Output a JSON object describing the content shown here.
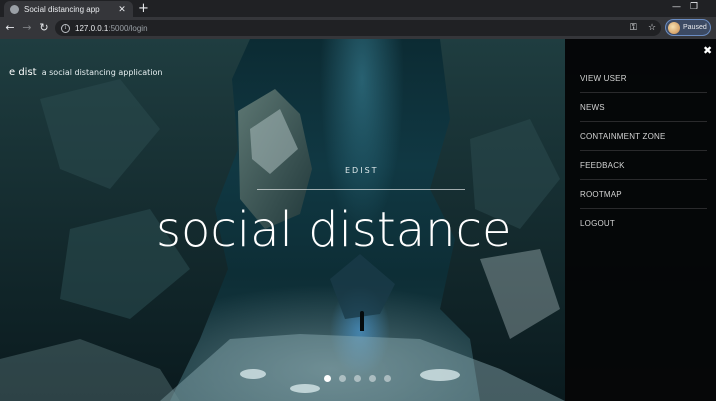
{
  "browser": {
    "tab_title": "Social distancing app",
    "tab_close": "✕",
    "new_tab": "+",
    "url_host": "127.0.0.1",
    "url_path": ":5000/login",
    "profile_label": "Paused",
    "icons": {
      "back": "back-arrow-icon",
      "forward": "forward-arrow-icon",
      "reload": "reload-icon",
      "info": "site-info-icon",
      "key": "password-key-icon",
      "star": "bookmark-star-icon",
      "minimize": "minimize-icon",
      "restore": "restore-icon"
    }
  },
  "page": {
    "brand_name": "e dist",
    "brand_tagline": "a social distancing application",
    "eyebrow": "EDIST",
    "hero_title": "social distance",
    "carousel": {
      "count": 5,
      "active_index": 0
    }
  },
  "menu": {
    "close_label": "✖",
    "items": [
      {
        "label": "VIEW USER"
      },
      {
        "label": "NEWS"
      },
      {
        "label": "CONTAINMENT ZONE"
      },
      {
        "label": "FEEDBACK"
      },
      {
        "label": "ROOTMAP"
      },
      {
        "label": "LOGOUT"
      }
    ]
  },
  "colors": {
    "menu_bg": "#050506",
    "hero_text": "#ffffff",
    "chrome_bg": "#35363a"
  }
}
